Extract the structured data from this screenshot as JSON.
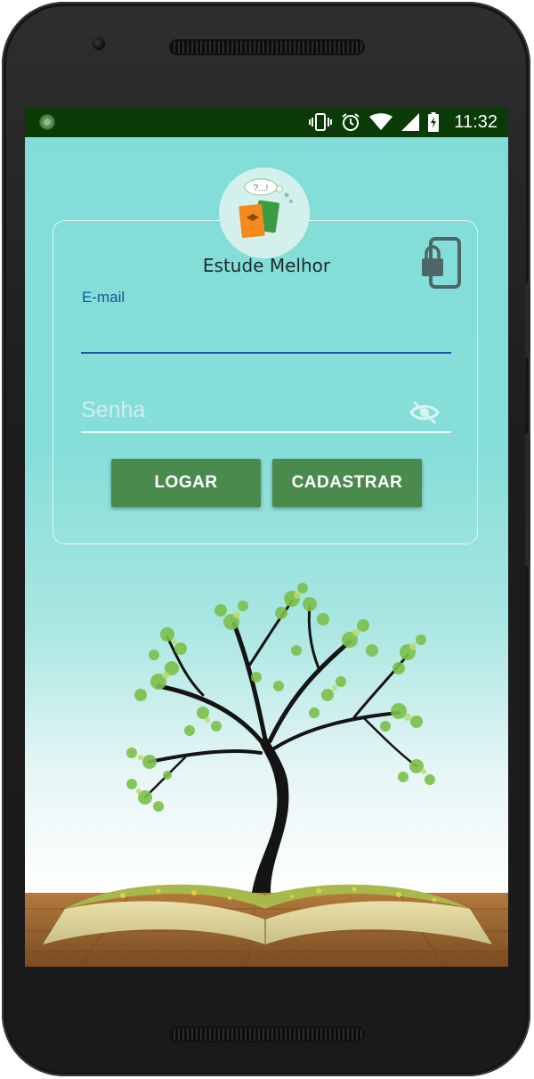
{
  "status_bar": {
    "time": "11:32",
    "icons": [
      "app-notification-icon",
      "vibrate-icon",
      "alarm-icon",
      "wifi-icon",
      "cell-signal-icon",
      "battery-charging-icon"
    ]
  },
  "app": {
    "name": "Estude Melhor",
    "logo_bubble_text": "?...!"
  },
  "login_form": {
    "email_label": "E-mail",
    "email_value": "",
    "password_placeholder": "Senha",
    "password_value": "",
    "login_button": "LOGAR",
    "register_button": "CADASTRAR"
  },
  "colors": {
    "status_bar_bg": "#0a3a05",
    "screen_bg_top": "#82ddd8",
    "accent_blue": "#15549c",
    "button_green": "#4b8a4d",
    "button_text": "#ffffff"
  }
}
